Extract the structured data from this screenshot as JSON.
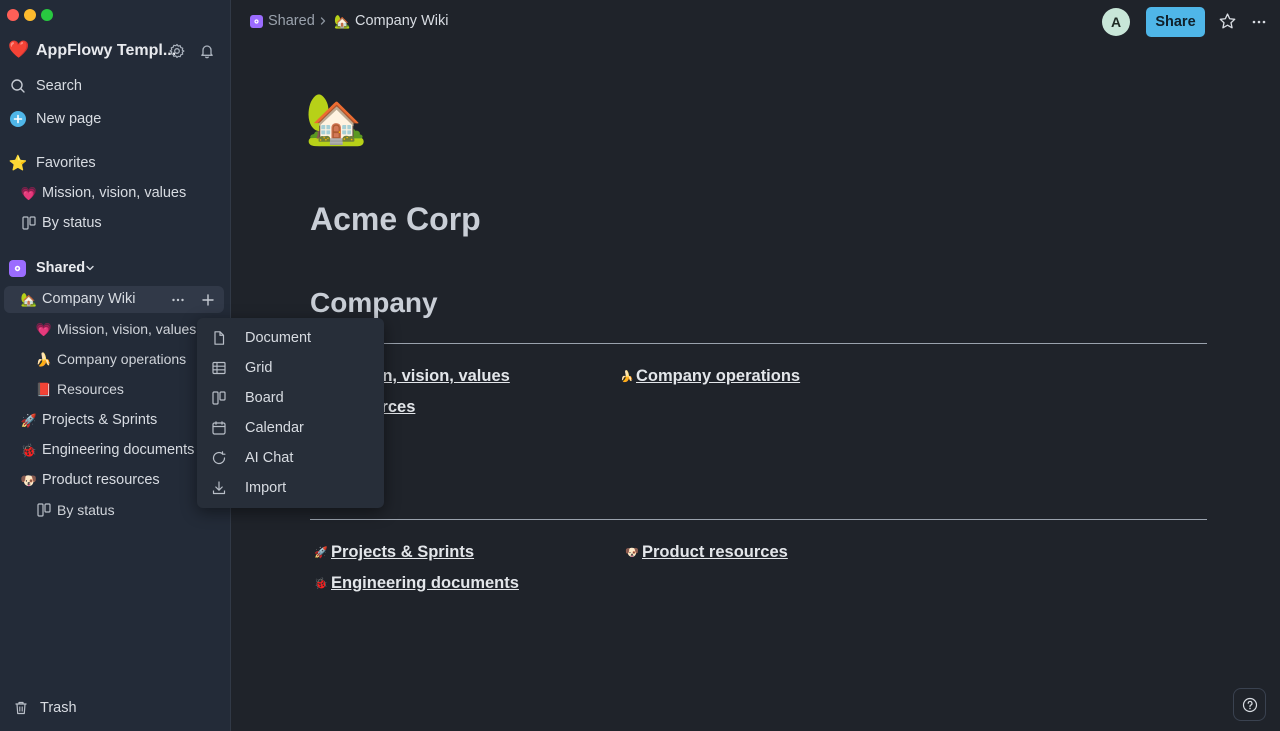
{
  "window": {
    "traffic_colors": [
      "#ff5f57",
      "#febc2e",
      "#28c840"
    ]
  },
  "workspace": {
    "name": "AppFlowy Templ...",
    "emoji": "❤️"
  },
  "sidebar": {
    "search_label": "Search",
    "new_page_label": "New page",
    "favorites_label": "Favorites",
    "favorites": [
      {
        "emoji": "💗",
        "label": "Mission, vision, values"
      },
      {
        "label": "By status",
        "icon": "board-icon"
      }
    ],
    "shared_label": "Shared",
    "shared": {
      "company_wiki": {
        "emoji": "🏡",
        "label": "Company Wiki"
      },
      "children": [
        {
          "emoji": "💗",
          "label": "Mission, vision, values"
        },
        {
          "emoji": "🍌",
          "label": "Company operations"
        },
        {
          "emoji": "📕",
          "label": "Resources"
        }
      ],
      "projects": {
        "emoji": "🚀",
        "label": "Projects & Sprints"
      },
      "engineering": {
        "emoji": "🐞",
        "label": "Engineering documents"
      },
      "product": {
        "emoji": "🐶",
        "label": "Product resources"
      },
      "product_child": {
        "label": "By status",
        "icon": "board-icon"
      }
    },
    "trash_label": "Trash"
  },
  "header": {
    "breadcrumb": [
      {
        "label": "Shared",
        "icon": "shared-space-icon"
      },
      {
        "emoji": "🏡",
        "label": "Company Wiki"
      }
    ],
    "avatar_initial": "A",
    "share_label": "Share"
  },
  "content": {
    "page_icon": "🏡",
    "title": "Acme Corp",
    "section_heading": "Company",
    "links_row1_col1": {
      "emoji": "💗",
      "text": "Mission, vision, values"
    },
    "links_row1_col2": {
      "emoji": "🍌",
      "text": "Company operations"
    },
    "links_row2_col1": {
      "emoji": "📕",
      "text": "Resources"
    },
    "links_row3_col1": {
      "emoji": "🚀",
      "text": "Projects & Sprints"
    },
    "links_row3_col2": {
      "emoji": "🐶",
      "text": "Product resources"
    },
    "links_row4_col1": {
      "emoji": "🐞",
      "text": "Engineering documents"
    }
  },
  "add_menu": {
    "items": [
      {
        "label": "Document",
        "icon": "document-icon"
      },
      {
        "label": "Grid",
        "icon": "grid-icon"
      },
      {
        "label": "Board",
        "icon": "board-icon"
      },
      {
        "label": "Calendar",
        "icon": "calendar-icon"
      },
      {
        "label": "AI Chat",
        "icon": "ai-chat-icon"
      },
      {
        "label": "Import",
        "icon": "import-icon"
      }
    ]
  },
  "colors": {
    "accent": "#4fb6e8",
    "shared_badge": "#9b6cff",
    "new_page_icon": "#4fb6e8"
  }
}
